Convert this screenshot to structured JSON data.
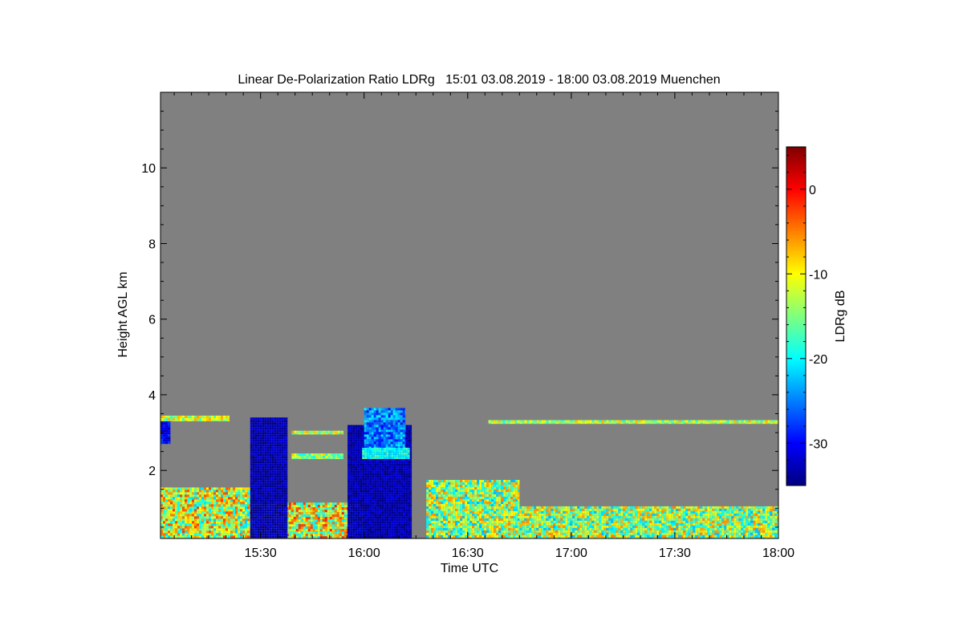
{
  "chart_data": {
    "type": "heatmap",
    "title": "Linear De-Polarization Ratio LDRg   15:01 03.08.2019 - 18:00 03.08.2019 Muenchen",
    "xlabel": "Time UTC",
    "ylabel": "Height AGL km",
    "colorbar_label": "LDRg dB",
    "x_unit": "hours UTC",
    "xlim": [
      15.017,
      18.0
    ],
    "ylim": [
      0.2,
      12.0
    ],
    "x_ticks": [
      {
        "value": 15.5,
        "label": "15:30"
      },
      {
        "value": 16.0,
        "label": "16:00"
      },
      {
        "value": 16.5,
        "label": "16:30"
      },
      {
        "value": 17.0,
        "label": "17:00"
      },
      {
        "value": 17.5,
        "label": "17:30"
      },
      {
        "value": 18.0,
        "label": "18:00"
      }
    ],
    "y_ticks": [
      {
        "value": 2,
        "label": "2"
      },
      {
        "value": 4,
        "label": "4"
      },
      {
        "value": 6,
        "label": "6"
      },
      {
        "value": 8,
        "label": "8"
      },
      {
        "value": 10,
        "label": "10"
      }
    ],
    "colorbar_range": [
      -35,
      5
    ],
    "colorbar_ticks": [
      {
        "value": 0,
        "label": "0"
      },
      {
        "value": -10,
        "label": "-10"
      },
      {
        "value": -20,
        "label": "-20"
      },
      {
        "value": -30,
        "label": "-30"
      }
    ],
    "colormap": [
      "#00007f",
      "#0000ff",
      "#007fff",
      "#00ffff",
      "#7fff7f",
      "#ffff00",
      "#ff7f00",
      "#ff0000",
      "#7f0000"
    ],
    "no_data_color": "#808080",
    "regions": [
      {
        "name": "boundary-layer-1",
        "x": [
          15.017,
          15.45
        ],
        "y": [
          0.2,
          1.55
        ],
        "value": -12,
        "spread": 10
      },
      {
        "name": "boundary-layer-2",
        "x": [
          15.45,
          16.0
        ],
        "y": [
          0.2,
          1.15
        ],
        "value": -11,
        "spread": 10
      },
      {
        "name": "boundary-layer-3",
        "x": [
          16.3,
          16.75
        ],
        "y": [
          0.2,
          1.75
        ],
        "value": -14,
        "spread": 9
      },
      {
        "name": "boundary-layer-4",
        "x": [
          16.75,
          18.0
        ],
        "y": [
          0.2,
          1.05
        ],
        "value": -14,
        "spread": 9
      },
      {
        "name": "rain-shaft-1",
        "x": [
          15.45,
          15.63
        ],
        "y": [
          0.2,
          3.4
        ],
        "value": -33,
        "spread": 2
      },
      {
        "name": "rain-shaft-2",
        "x": [
          15.92,
          16.23
        ],
        "y": [
          0.2,
          3.2
        ],
        "value": -33,
        "spread": 2
      },
      {
        "name": "cloud-top",
        "x": [
          16.0,
          16.2
        ],
        "y": [
          2.5,
          3.65
        ],
        "value": -25,
        "spread": 5
      },
      {
        "name": "melting-layer",
        "x": [
          15.99,
          16.22
        ],
        "y": [
          2.3,
          2.6
        ],
        "value": -19,
        "spread": 3
      },
      {
        "name": "cloud-edge-left",
        "x": [
          15.017,
          15.065
        ],
        "y": [
          2.7,
          3.4
        ],
        "value": -30,
        "spread": 3
      },
      {
        "name": "thin-layer-1",
        "x": [
          15.017,
          15.35
        ],
        "y": [
          3.3,
          3.45
        ],
        "value": -12,
        "spread": 6
      },
      {
        "name": "thin-layer-2",
        "x": [
          15.65,
          15.9
        ],
        "y": [
          2.3,
          2.45
        ],
        "value": -14,
        "spread": 6
      },
      {
        "name": "thin-layer-3",
        "x": [
          15.65,
          15.9
        ],
        "y": [
          2.95,
          3.05
        ],
        "value": -12,
        "spread": 6
      },
      {
        "name": "thin-layer-4",
        "x": [
          16.6,
          18.0
        ],
        "y": [
          3.23,
          3.33
        ],
        "value": -13,
        "spread": 6
      }
    ]
  }
}
